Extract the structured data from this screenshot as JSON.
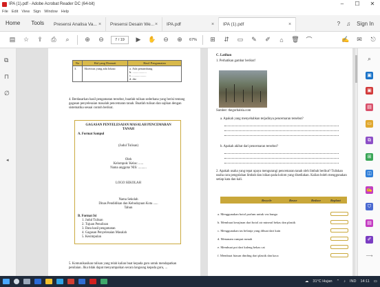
{
  "window": {
    "title": "IPA (1).pdf - Adobe Acrobat Reader DC (64-bit)",
    "menu": [
      "File",
      "Edit",
      "View",
      "Sign",
      "Window",
      "Help"
    ]
  },
  "tabs": {
    "home": "Home",
    "tools": "Tools",
    "docs": [
      {
        "label": "Presensi Analisa Va..."
      },
      {
        "label": "Presensi Desain We..."
      },
      {
        "label": "IPA.pdf"
      },
      {
        "label": "IPA (1).pdf",
        "active": true
      }
    ],
    "close_symbol": "×",
    "sign_in": "Sign In"
  },
  "toolbar": {
    "page_current": "7",
    "page_total": "19",
    "page_display": "7 / 19",
    "zoom": "67%"
  },
  "page1": {
    "table_headers": [
      "No",
      "Hal yang Diamati",
      "Hasil Pengamatan"
    ],
    "table_row_no": "3.",
    "table_row_item": "Aktivitas yang ada lokasi",
    "table_row_results": [
      "a.  Ada penambang",
      "b.  ..................",
      "c.  ..................",
      "d.  dst"
    ],
    "step4": "4.  Berdasarkan hasil pengamatan tersebut, buatlah tulisan sederhana yang berisi tentang gagasan penyelesaian masalah pencemaran tanah. Buatlah tulisan dan sajikan dengan sistematika sesuai contoh berikut.",
    "frame_title_1": "GAGASAN PENYELESAIAN MASALAH PENCEMARAN",
    "frame_title_2": "TANAH",
    "format_sampul": "A.  Format Sampul",
    "judul": "(Judul Tulisan)",
    "oleh": "Oleh",
    "kelompok": "Kelompok/ Kelas: ......",
    "nama": "Nama anggota/ NIS: ..........",
    "logo": "LOGO SEKOLAH",
    "nama_sekolah": "Nama Sekolah",
    "dinas": "Dinas Pendidikan dan Kebudayaan Kota ......",
    "tahun": "Tahun",
    "format_isi": "B.  Format Isi",
    "isi_items": [
      "1.  Judul Tulisan",
      "2.  Tujuan Penulisan",
      "3.  Data hasil pengamatan",
      "4.  Gagasan Penyelesaian Masalah",
      "5.  Kesimpulan"
    ],
    "step5": "5.  Komunikasikan tulisan yang telah kalian buat kepada guru untuk mendapatkan penilaian. Jika tidak dapat menyampaikan secara langsung kepada guru, ..."
  },
  "page2": {
    "section": "C.  Latihan",
    "q1": "1.  Perhatikan gambar berikut!",
    "source": "Sumber: thegorbalsla.com",
    "qa": "a.  Apakah yang menyebabkan terjadinya pencemaran tersebut?",
    "qb": "b.  Apakah akibat dari pencemaran tersebut?",
    "q2": "2.  Apakah usaha yang tepat upaya mengurangi pencemaran tanah oleh limbah berikut? Tuliskan usaha cara pengolahan limbah dan isikan pada kolom yang disediakan. Kalian boleh menggunakan setiap kata dan kali.",
    "headers": [
      "Recycle",
      "Reuse",
      "Reduce",
      "Replant"
    ],
    "items": [
      "a.  Menggunakan botol parfum untuk vas bunga",
      "b.  Membuat kerajinan dari botol air mineral bekas dan plastik",
      "c.  Menggunakan tas belanja yang dibuat dari kain",
      "d.  Menanam rumput rumah",
      "e.  Membuat pot dari kaleng bekas cat",
      "f.  Membuat hiasan dinding dari plastik dan kaca"
    ]
  },
  "taskbar": {
    "weather": "31°C Hujan",
    "time": "14:11",
    "lang": "IND"
  },
  "colors": {
    "acrobat_red": "#d21f1f",
    "gold": "#c9a73a",
    "taskbar": "#1f2a3a"
  }
}
